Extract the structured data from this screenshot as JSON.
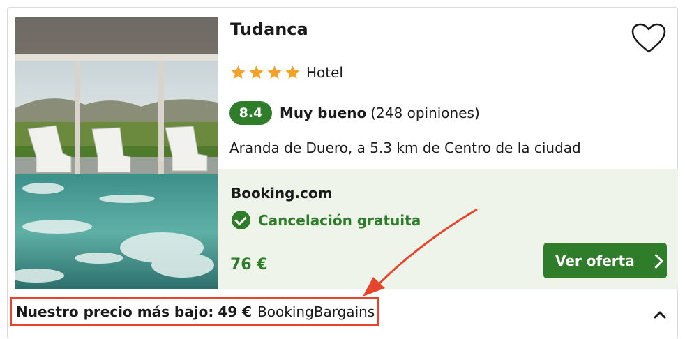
{
  "hotel": {
    "name": "Tudanca",
    "stars": 4,
    "type": "Hotel",
    "rating_score": "8.4",
    "rating_label": "Muy bueno",
    "reviews": "(248 opiniones)",
    "location": "Aranda de Duero, a 5.3 km de Centro de la ciudad",
    "photo_description": "star-rating-icon"
  },
  "deal": {
    "provider": "Booking.com",
    "cancellation": "Cancelación gratuita",
    "price": "76 €",
    "button_label": "Ver oferta"
  },
  "lowest_price": {
    "label": "Nuestro precio más bajo:",
    "value": "49 €",
    "source": "BookingBargains"
  },
  "colors": {
    "green": "#2f7d2b",
    "star": "#f4a32a",
    "deal_bg": "#eef4ea",
    "highlight": "#e5452b"
  },
  "icons": {
    "favorite": "heart-icon",
    "check": "check-circle-icon",
    "button_arrow": "chevron-right-icon",
    "collapse": "chevron-up-icon"
  }
}
